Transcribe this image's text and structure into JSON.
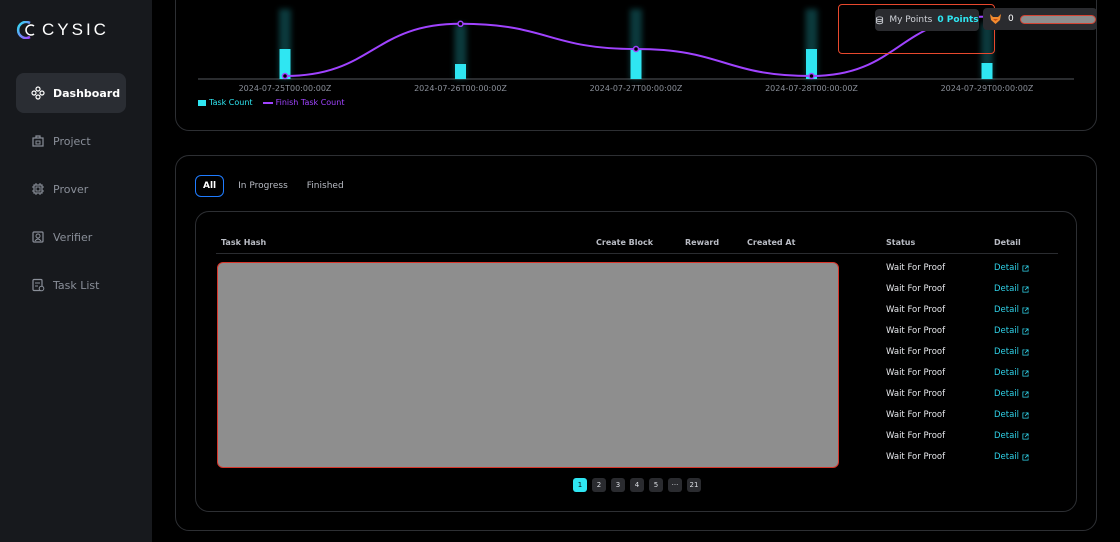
{
  "brand": {
    "name": "CYSIC"
  },
  "sidebar": {
    "items": [
      {
        "label": "Dashboard",
        "icon": "dashboard-icon",
        "active": true
      },
      {
        "label": "Project",
        "icon": "project-icon",
        "active": false
      },
      {
        "label": "Prover",
        "icon": "prover-chip-icon",
        "active": false
      },
      {
        "label": "Verifier",
        "icon": "verifier-icon",
        "active": false
      },
      {
        "label": "Task List",
        "icon": "task-list-icon",
        "active": false
      }
    ]
  },
  "header": {
    "points_label": "My Points",
    "points_value": "0 Points",
    "user_balance": "0"
  },
  "chart_data": {
    "type": "bar",
    "categories": [
      "2024-07-25T00:00:00Z",
      "2024-07-26T00:00:00Z",
      "2024-07-27T00:00:00Z",
      "2024-07-28T00:00:00Z",
      "2024-07-29T00:00:00Z"
    ],
    "series": [
      {
        "name": "Task Count",
        "type": "bar",
        "color": "#2fe6f2",
        "values": [
          30,
          15,
          30,
          30,
          16
        ]
      },
      {
        "name": "Finish Task Count",
        "type": "line",
        "color": "#a043ff",
        "values": [
          0,
          58,
          30,
          0,
          66
        ]
      }
    ],
    "legend_position": "bottom-left"
  },
  "tabs": [
    {
      "label": "All",
      "active": true
    },
    {
      "label": "In Progress",
      "active": false
    },
    {
      "label": "Finished",
      "active": false
    }
  ],
  "table": {
    "headers": {
      "task_hash": "Task Hash",
      "create_block": "Create Block",
      "reward": "Reward",
      "created_at": "Created At",
      "status": "Status",
      "detail": "Detail"
    },
    "rows": [
      {
        "status": "Wait For Proof",
        "detail": "Detail"
      },
      {
        "status": "Wait For Proof",
        "detail": "Detail"
      },
      {
        "status": "Wait For Proof",
        "detail": "Detail"
      },
      {
        "status": "Wait For Proof",
        "detail": "Detail"
      },
      {
        "status": "Wait For Proof",
        "detail": "Detail"
      },
      {
        "status": "Wait For Proof",
        "detail": "Detail"
      },
      {
        "status": "Wait For Proof",
        "detail": "Detail"
      },
      {
        "status": "Wait For Proof",
        "detail": "Detail"
      },
      {
        "status": "Wait For Proof",
        "detail": "Detail"
      },
      {
        "status": "Wait For Proof",
        "detail": "Detail"
      }
    ]
  },
  "pagination": {
    "pages": [
      "1",
      "2",
      "3",
      "4",
      "5",
      "···",
      "21"
    ],
    "current": "1"
  },
  "colors": {
    "accent": "#2fe6f2",
    "line": "#a043ff",
    "highlight": "#e8482d",
    "active_tab_border": "#1f7cff"
  }
}
